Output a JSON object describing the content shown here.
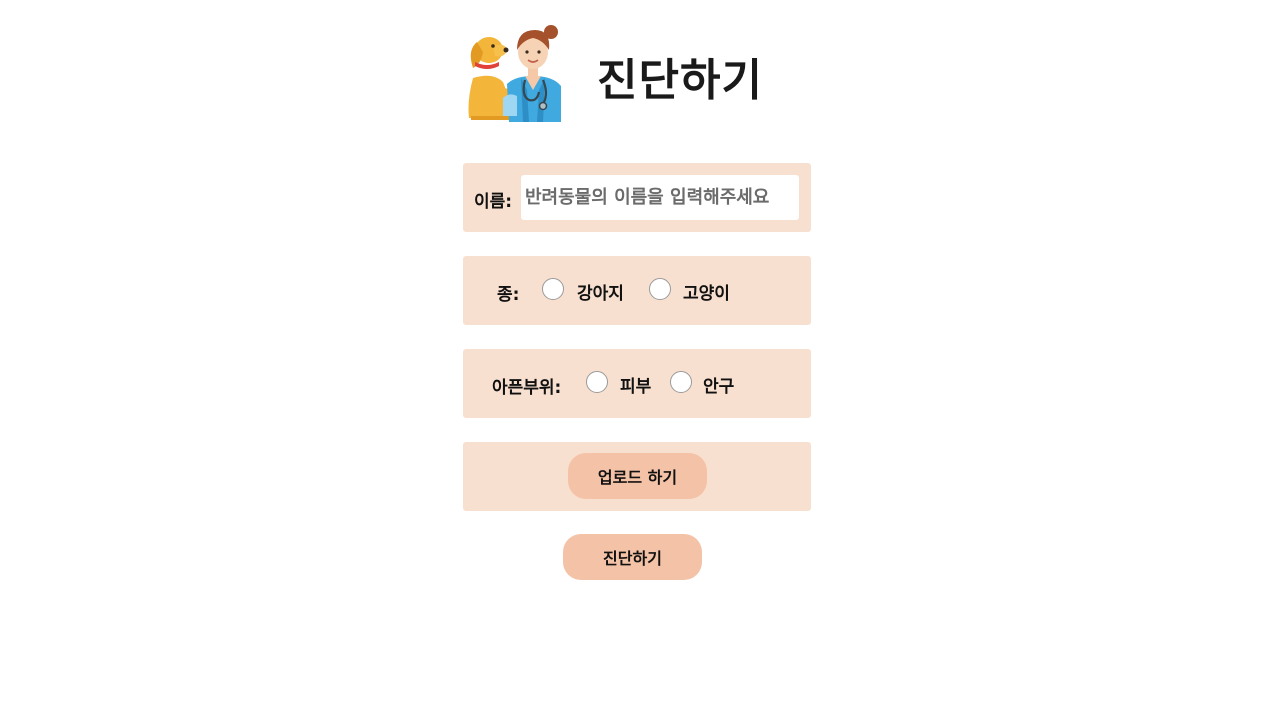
{
  "header": {
    "title": "진단하기",
    "illustration": "vet-with-dog-illustration"
  },
  "form": {
    "name": {
      "label": "이름:",
      "placeholder": "반려동물의 이름을 입력해주세요",
      "value": ""
    },
    "species": {
      "label": "종:",
      "options": [
        "강아지",
        "고양이"
      ],
      "selected": null
    },
    "affected_part": {
      "label": "아픈부위:",
      "options": [
        "피부",
        "안구"
      ],
      "selected": null
    },
    "upload_button": "업로드 하기"
  },
  "actions": {
    "diagnose_button": "진단하기"
  },
  "colors": {
    "panel_background": "#f8e0d0",
    "button_background": "#f4c2a6",
    "page_background": "#ffffff"
  }
}
